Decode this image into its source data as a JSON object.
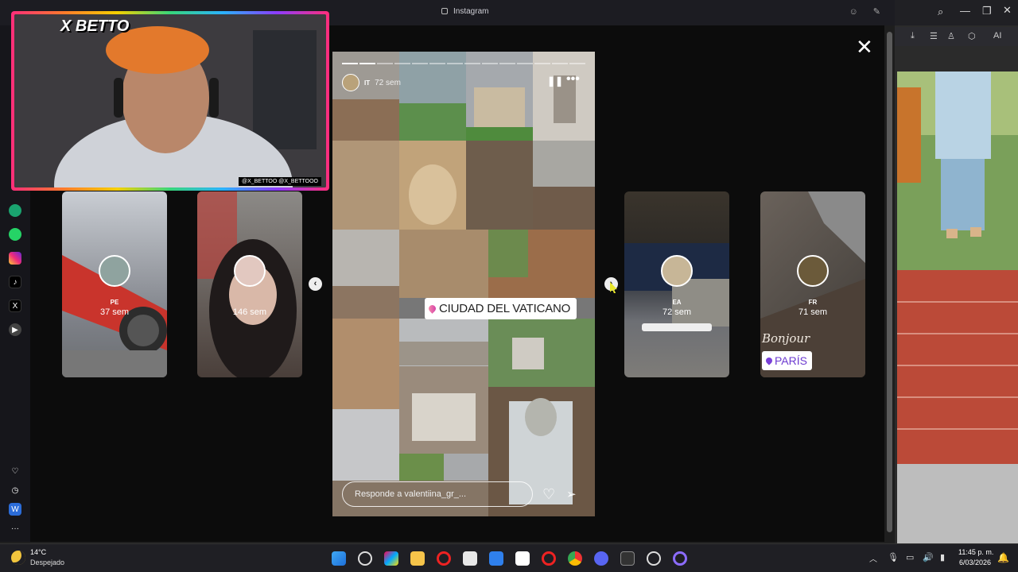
{
  "browser": {
    "page_title": "Instagram"
  },
  "webcam": {
    "title": "X BETTO",
    "handles": "@X_BETTOO  @X_BETTOOO"
  },
  "story": {
    "user_code": "IT",
    "age": "72 sem",
    "location_label": "CIUDAD DEL VATICANO",
    "reply_placeholder": "Responde a valentiina_gr_...",
    "progress_segments": 14,
    "progress_done": 2
  },
  "previews": [
    {
      "code": "PE",
      "age": "37 sem"
    },
    {
      "code": "",
      "age": "146 sem"
    },
    {
      "code": "EA",
      "age": "72 sem"
    },
    {
      "code": "FR",
      "age": "71 sem",
      "text": "Bonjour",
      "location": "PARÍS"
    }
  ],
  "taskbar": {
    "temperature": "14°C",
    "weather": "Despejado",
    "time": "11:45 p. m.",
    "date": "6/03/2026"
  },
  "right_window": {
    "toolbar_ai": "AI"
  },
  "icons": {
    "close": "close-icon",
    "pause": "pause-icon",
    "more": "more-icon",
    "like": "heart-icon",
    "send": "send-icon"
  }
}
